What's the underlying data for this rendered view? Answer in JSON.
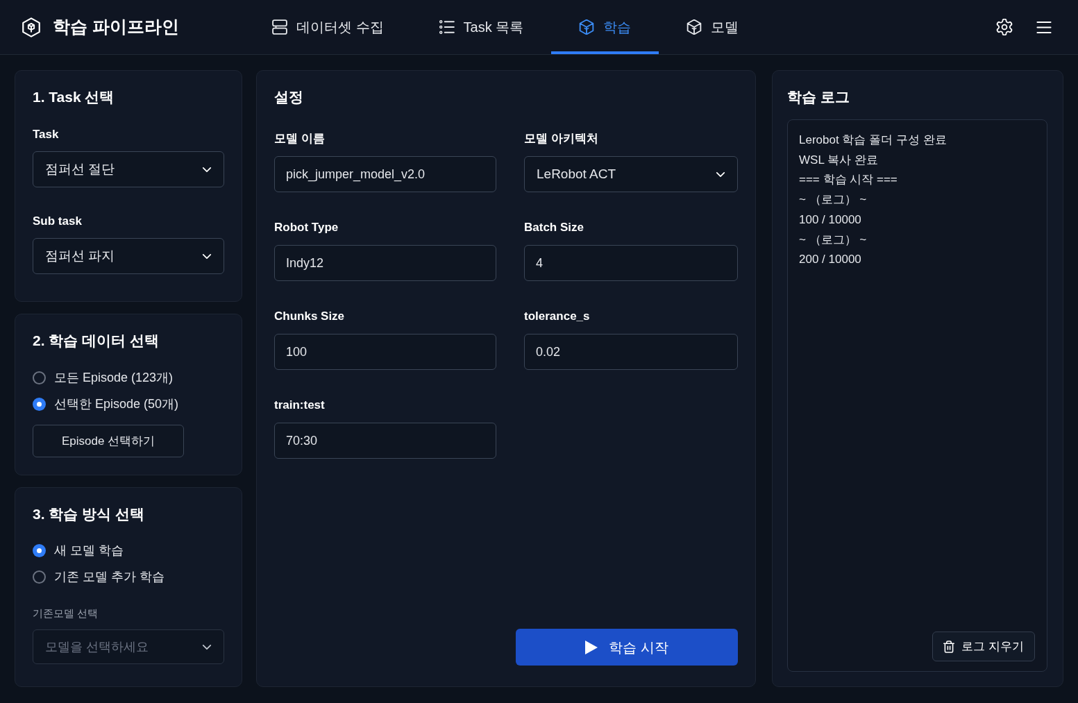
{
  "app": {
    "title": "학습 파이프라인"
  },
  "nav_tabs": [
    {
      "label": "데이터셋 수집",
      "selected": false
    },
    {
      "label": "Task 목록",
      "selected": false
    },
    {
      "label": "학습",
      "selected": true
    },
    {
      "label": "모델",
      "selected": false
    }
  ],
  "task_panel": {
    "title": "1. Task 선택",
    "fields": [
      {
        "label": "Task",
        "value": "점퍼선 절단"
      },
      {
        "label": "Sub task",
        "value": "점퍼선 파지"
      }
    ]
  },
  "data_panel": {
    "title": "2. 학습 데이터 선택",
    "options": [
      {
        "label": "모든 Episode (123개)",
        "selected": false
      },
      {
        "label": "선택한 Episode (50개)",
        "selected": true
      }
    ],
    "button": "Episode 선택하기"
  },
  "method_panel": {
    "title": "3. 학습 방식 선택",
    "options": [
      {
        "label": "새 모델 학습",
        "selected": true
      },
      {
        "label": "기존 모델 추가 학습",
        "selected": false
      }
    ],
    "base_model": {
      "label": "기존모델 선택",
      "placeholder": "모델을 선택하세요",
      "disabled": true
    }
  },
  "settings": {
    "title": "설정",
    "fields": [
      {
        "label": "모델 이름",
        "kind": "input",
        "value": "pick_jumper_model_v2.0"
      },
      {
        "label": "모델 아키텍처",
        "kind": "select",
        "value": "LeRobot ACT"
      },
      {
        "label": "Robot Type",
        "kind": "input",
        "value": "Indy12"
      },
      {
        "label": "Batch Size",
        "kind": "input",
        "value": "4"
      },
      {
        "label": "Chunks Size",
        "kind": "input",
        "value": "100"
      },
      {
        "label": "tolerance_s",
        "kind": "input",
        "value": "0.02"
      },
      {
        "label": "train:test",
        "kind": "input",
        "value": "70:30"
      }
    ],
    "start_button": "학습 시작"
  },
  "log": {
    "title": "학습 로그",
    "lines": [
      "Lerobot 학습 폴더 구성 완료",
      "WSL 복사 완료",
      "=== 학습 시작 ===",
      "~ （로그） ~",
      "100 / 10000",
      "~ （로그） ~",
      "200 / 10000"
    ],
    "clear_button": "로그 지우기"
  }
}
